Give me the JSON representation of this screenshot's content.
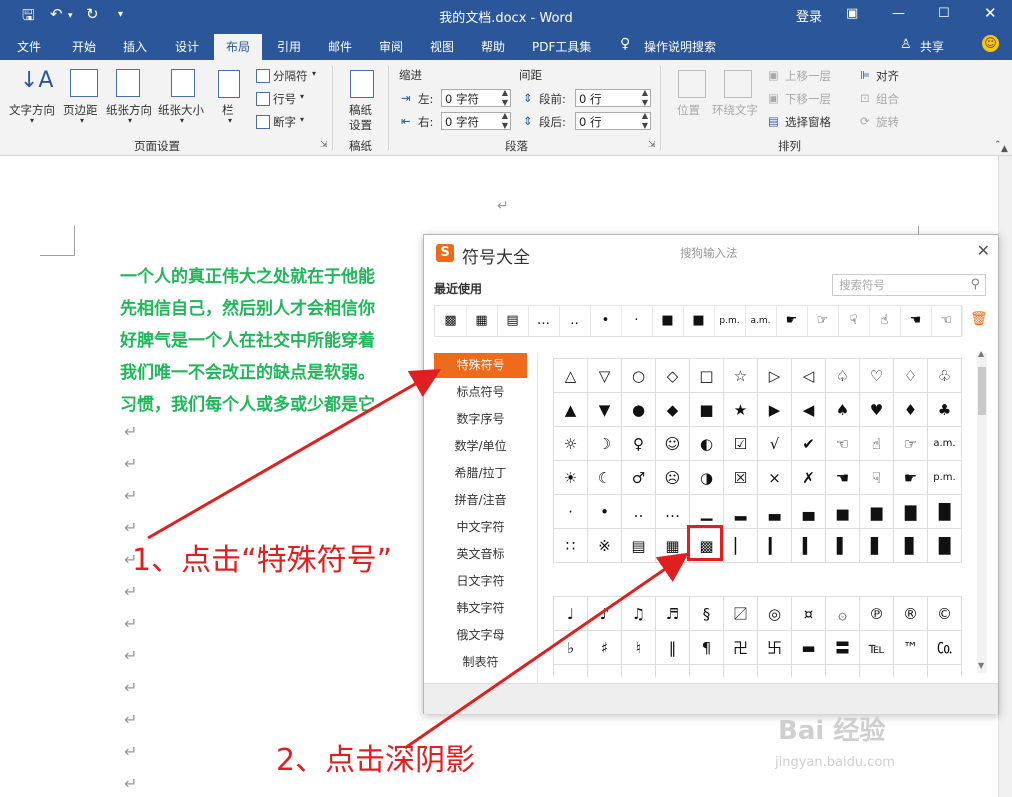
{
  "window": {
    "title": "我的文档.docx - Word",
    "login": "登录",
    "share": "共享"
  },
  "tabs": [
    "文件",
    "开始",
    "插入",
    "设计",
    "布局",
    "引用",
    "邮件",
    "审阅",
    "视图",
    "帮助",
    "PDF工具集"
  ],
  "tellme": "操作说明搜索",
  "ribbon": {
    "page_setup": {
      "label": "页面设置",
      "text_direction": "文字方向",
      "margins": "页边距",
      "orientation": "纸张方向",
      "size": "纸张大小",
      "columns": "栏",
      "breaks": "分隔符",
      "line_numbers": "行号",
      "hyphenation": "断字"
    },
    "manuscript": {
      "label": "稿纸",
      "button_line1": "稿纸",
      "button_line2": "设置"
    },
    "paragraph": {
      "label": "段落",
      "indent": "缩进",
      "spacing": "间距",
      "left_label": "左:",
      "right_label": "右:",
      "before_label": "段前:",
      "after_label": "段后:",
      "left_value": "0 字符",
      "right_value": "0 字符",
      "before_value": "0 行",
      "after_value": "0 行"
    },
    "arrange": {
      "label": "排列",
      "position": "位置",
      "wrap": "环绕文字",
      "bring_forward": "上移一层",
      "send_backward": "下移一层",
      "selection_pane": "选择窗格",
      "align": "对齐",
      "group": "组合",
      "rotate": "旋转"
    }
  },
  "document": {
    "lines": [
      "一个人的真正伟大之处就在于他能",
      "先相信自己，然后别人才会相信你",
      "好脾气是一个人在社交中所能穿着",
      "我们唯一不会改正的缺点是软弱。",
      "习惯，我们每个人或多或少都是它"
    ],
    "paragraph_mark": "↵"
  },
  "dialog": {
    "title": "符号大全",
    "ime": "搜狗输入法",
    "recent_label": "最近使用",
    "search_placeholder": "搜索符号",
    "recent_symbols": [
      "▩",
      "▦",
      "▤",
      "…",
      "‥",
      "•",
      "·",
      "■",
      "■",
      "p.m.",
      "a.m.",
      "☛",
      "☞",
      "☟",
      "☝",
      "☚",
      "☜"
    ],
    "categories": [
      "特殊符号",
      "标点符号",
      "数字序号",
      "数学/单位",
      "希腊/拉丁",
      "拼音/注音",
      "中文字符",
      "英文音标",
      "日文字符",
      "韩文字符",
      "俄文字母",
      "制表符"
    ],
    "selected_category": "特殊符号",
    "grid1": [
      [
        "△",
        "▽",
        "○",
        "◇",
        "□",
        "☆",
        "▷",
        "◁",
        "♤",
        "♡",
        "♢",
        "♧"
      ],
      [
        "▲",
        "▼",
        "●",
        "◆",
        "■",
        "★",
        "▶",
        "◀",
        "♠",
        "♥",
        "♦",
        "♣"
      ],
      [
        "☼",
        "☽",
        "♀",
        "☺",
        "◐",
        "☑",
        "√",
        "✔",
        "☜",
        "☝",
        "☞",
        "a.m."
      ],
      [
        "☀",
        "☾",
        "♂",
        "☹",
        "◑",
        "☒",
        "×",
        "✗",
        "☚",
        "☟",
        "☛",
        "p.m."
      ],
      [
        "·",
        "•",
        "‥",
        "…",
        "▁",
        "▂",
        "▃",
        "▄",
        "▅",
        "▆",
        "▇",
        "█"
      ],
      [
        "∷",
        "※",
        "▤",
        "▦",
        "▩",
        "▏",
        "▎",
        "▍",
        "▌",
        "▋",
        "▊",
        "█"
      ]
    ],
    "grid2": [
      [
        "♩",
        "♪",
        "♫",
        "♬",
        "§",
        "〼",
        "◎",
        "¤",
        "۞",
        "℗",
        "®",
        "©"
      ],
      [
        "♭",
        "♯",
        "♮",
        "‖",
        "¶",
        "卍",
        "卐",
        "▬",
        "〓",
        "℡",
        "™",
        "㏇"
      ],
      [
        "",
        "",
        "",
        "",
        "",
        "",
        "",
        "",
        "",
        "",
        "",
        ""
      ]
    ]
  },
  "annotations": {
    "step1": "1、点击“特殊符号”",
    "step2": "2、点击深阴影"
  },
  "watermark": {
    "brand": "Bai 经验",
    "url": "jingyan.baidu.com"
  }
}
